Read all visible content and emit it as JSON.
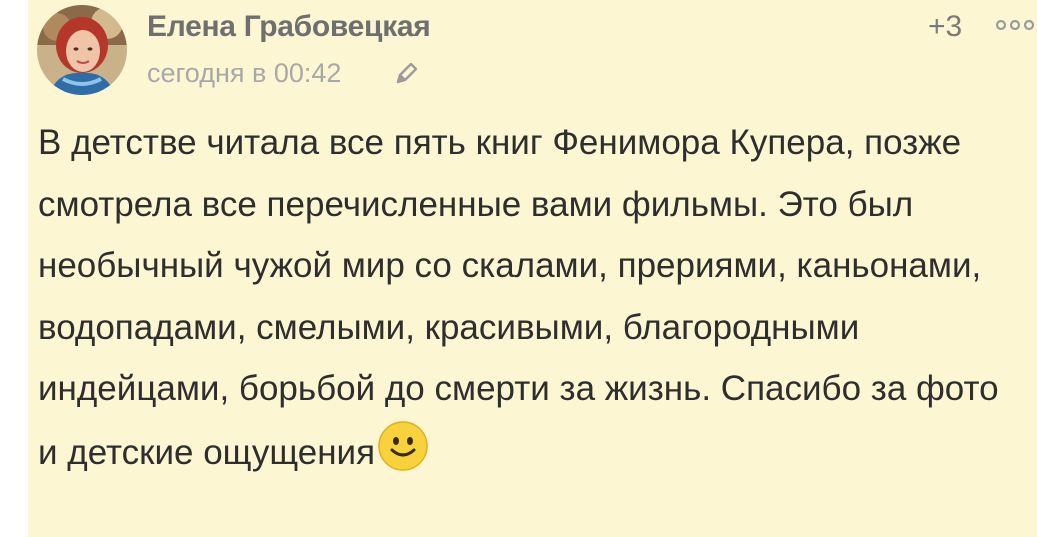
{
  "comment": {
    "author": "Елена Грабовецкая",
    "timestamp": "сегодня в 00:42",
    "score": "+3",
    "text": "В детстве читала все пять книг Фенимора Купера, позже смотрела все перечисленные вами фильмы. Это был необычный чужой мир со скалами, прериями, каньонами, водопадами, смелыми, красивыми, благородными индейцами, борьбой до смерти за жизнь. Спасибо за фото и детские ощущения"
  },
  "icons": {
    "avatar": "user-avatar-photo",
    "edit": "pencil-icon",
    "more": "more-dots-icon",
    "emoji": "smiley-emoji"
  },
  "colors": {
    "card_background": "#fdf6d2",
    "author": "#6f6f6f",
    "muted": "#a8a8a8",
    "text": "#2e2e2e"
  }
}
